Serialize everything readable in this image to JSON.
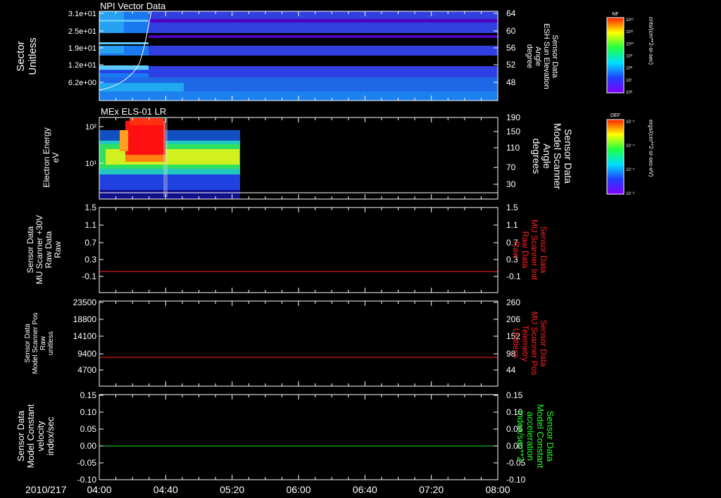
{
  "colors": {
    "background": "#000000",
    "axis": "#ffffff",
    "red_trace": "#ff2020",
    "green_trace": "#20e020",
    "red_label": "#ff2020",
    "green_label": "#20ff20"
  },
  "time_axis": {
    "date_label": "2010/217",
    "ticks": [
      "04:00",
      "04:40",
      "05:20",
      "06:00",
      "06:40",
      "07:20",
      "08:00"
    ]
  },
  "panels": [
    {
      "id": "npi",
      "title": "NPI Vector Data",
      "left_label": [
        "Sector",
        "Unitless"
      ],
      "left_ticks": [
        "3.1e+01",
        "2.5e+01",
        "1.9e+01",
        "1.2e+01",
        "6.2e+00"
      ],
      "right_label": [
        "Sensor Data",
        "ESH Sun Elevation",
        "Angle",
        "degree"
      ],
      "right_ticks": [
        "64",
        "60",
        "56",
        "52",
        "48"
      ],
      "colorbar": {
        "title": "NF",
        "unit": "cnts/(cm**2-sr-sec)",
        "tick_labels": [
          "10¹²",
          "10¹¹",
          "10¹⁰",
          "10⁹",
          "10⁸",
          "10⁷",
          "10⁶"
        ]
      }
    },
    {
      "id": "els",
      "title": "MEx ELS-01 LR",
      "left_label": [
        "Electron Energy",
        "eV"
      ],
      "left_ticks": [
        "10²",
        "10¹"
      ],
      "right_label": [
        "Sensor Data",
        "Model Scanner",
        "Angle",
        "degrees"
      ],
      "right_ticks": [
        "190",
        "150",
        "110",
        "70",
        "30"
      ],
      "colorbar": {
        "title": "DEF",
        "unit": "ergs/(cm**2-sr-sec-eV)",
        "tick_labels": [
          "10⁻³",
          "10⁻⁴",
          "10⁻⁵",
          "10⁻⁶"
        ]
      }
    },
    {
      "id": "mu_raw",
      "left_label": [
        "Sensor Data",
        "MU Scanner +30V",
        "Raw Data",
        "Raw"
      ],
      "left_ticks": [
        "1.5",
        "1.1",
        "0.7",
        "0.3",
        "-0.1"
      ],
      "right_label": [
        "Sensor Data",
        "MU Scanner Init",
        "Raw Data",
        "Raw"
      ],
      "right_ticks": [
        "1.5",
        "1.1",
        "0.7",
        "0.3",
        "-0.1"
      ]
    },
    {
      "id": "model_pos",
      "left_label": [
        "Sensor Data",
        "Model Scanner Pos",
        "Raw",
        "unitless"
      ],
      "left_ticks": [
        "23500",
        "18800",
        "14100",
        "9400",
        "4700"
      ],
      "right_label": [
        "Sensor Data",
        "MU Scanner Pos",
        "Telemetry",
        "Unitless"
      ],
      "right_ticks": [
        "260",
        "206",
        "152",
        "98",
        "44"
      ]
    },
    {
      "id": "model_const",
      "left_label": [
        "Sensor Data",
        "Model Constant",
        "velocity",
        "index/sec"
      ],
      "left_ticks": [
        "0.15",
        "0.10",
        "0.05",
        "0.00",
        "-0.05",
        "-0.10"
      ],
      "right_label": [
        "Sensor Data",
        "Model Constant",
        "acceleration",
        "index/sec**2"
      ],
      "right_ticks": [
        "0.15",
        "0.10",
        "0.05",
        "0.00",
        "-0.05",
        "-0.10"
      ]
    }
  ],
  "chart_data": [
    {
      "type": "heatmap",
      "title": "NPI Vector Data",
      "x_range": [
        "04:00",
        "08:00"
      ],
      "ylabel": "Sector Unitless",
      "ylim": [
        0,
        32
      ],
      "y2label": "Sensor Data ESH Sun Elevation Angle degree",
      "y2lim": [
        44,
        64
      ],
      "data_extent_end": "08:00",
      "overlay_line": {
        "name": "Sensor Data ESH Sun Elevation Angle",
        "x": [
          "04:00",
          "04:20",
          "04:30",
          "04:36",
          "04:40"
        ],
        "y": [
          44.5,
          48,
          53,
          60,
          64
        ]
      },
      "colorscale_log_range": [
        6,
        12
      ]
    },
    {
      "type": "heatmap",
      "title": "MEx ELS-01 LR",
      "x_range": [
        "04:00",
        "08:00"
      ],
      "ylabel": "Electron Energy eV",
      "y_scale": "log",
      "y2label": "Sensor Data Model Scanner Angle degrees",
      "y2lim": [
        10,
        190
      ],
      "data_extent_end": "05:20",
      "overlay_line": {
        "name": "Sensor Data Model Scanner Angle",
        "x": [
          "04:00",
          "08:00"
        ],
        "y": [
          10,
          10
        ]
      },
      "colorscale_log_range": [
        -6,
        -3
      ]
    },
    {
      "type": "line",
      "ylabel": "Sensor Data MU Scanner +30V Raw Data Raw",
      "ylim": [
        -0.3,
        1.5
      ],
      "y2label": "Sensor Data MU Scanner Init Raw Data Raw",
      "series": [
        {
          "name": "Sensor Data MU Scanner Init Raw Data",
          "x": [
            "04:00",
            "08:00"
          ],
          "y": [
            0.0,
            0.0
          ]
        }
      ]
    },
    {
      "type": "line",
      "ylabel": "Sensor Data Model Scanner Pos Raw unitless",
      "ylim": [
        0,
        23500
      ],
      "y2label": "Sensor Data MU Scanner Pos Telemetry Unitless",
      "y2lim": [
        -10,
        260
      ],
      "series": [
        {
          "name": "Sensor Data MU Scanner Pos Telemetry",
          "x": [
            "04:00",
            "08:00"
          ],
          "y": [
            8000,
            8000
          ]
        }
      ]
    },
    {
      "type": "line",
      "ylabel": "Sensor Data Model Constant velocity index/sec",
      "ylim": [
        -0.1,
        0.15
      ],
      "y2label": "Sensor Data Model Constant acceleration index/sec**2",
      "series": [
        {
          "name": "Sensor Data Model Constant acceleration",
          "x": [
            "04:00",
            "08:00"
          ],
          "y": [
            0.0,
            0.0
          ]
        }
      ]
    }
  ]
}
